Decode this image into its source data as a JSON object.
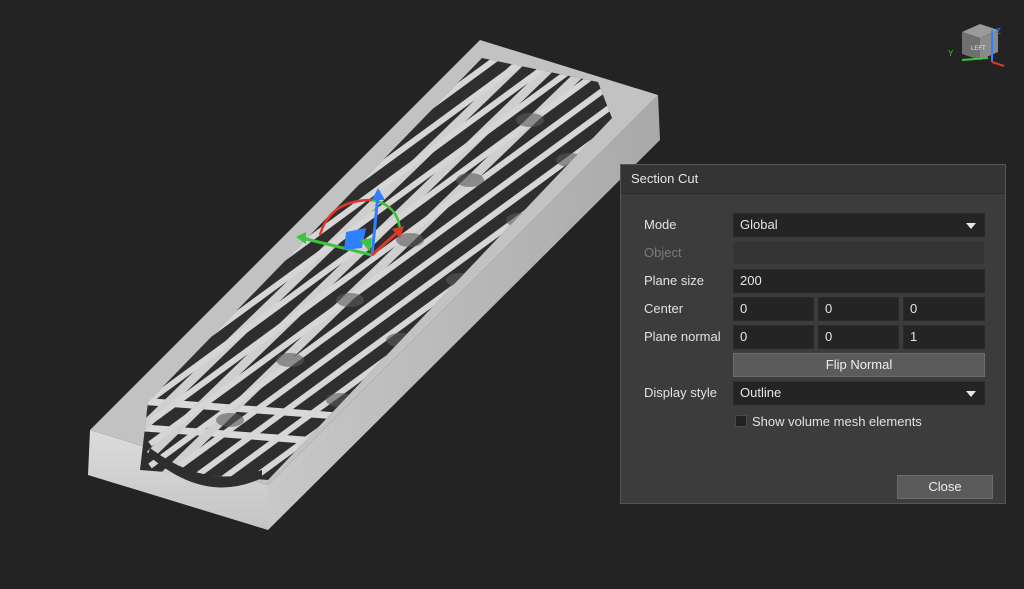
{
  "dialog": {
    "title": "Section Cut",
    "mode": {
      "label": "Mode",
      "value": "Global"
    },
    "object": {
      "label": "Object",
      "value": ""
    },
    "plane_size": {
      "label": "Plane size",
      "value": "200"
    },
    "center": {
      "label": "Center",
      "x": "0",
      "y": "0",
      "z": "0"
    },
    "plane_normal": {
      "label": "Plane normal",
      "x": "0",
      "y": "0",
      "z": "1"
    },
    "flip_normal_label": "Flip Normal",
    "display_style": {
      "label": "Display style",
      "value": "Outline"
    },
    "show_volume_mesh": {
      "label": "Show volume mesh elements",
      "checked": false
    },
    "close_label": "Close"
  },
  "view_cube": {
    "face_label": "LEFT",
    "axis_y": "Y",
    "axis_z": "Z"
  },
  "colors": {
    "background": "#232323",
    "part_top": "#bdbdbd",
    "part_side": "#d2d2d2",
    "gizmo_x": "#e0382a",
    "gizmo_y": "#3ec43e",
    "gizmo_z": "#2f7fff"
  }
}
